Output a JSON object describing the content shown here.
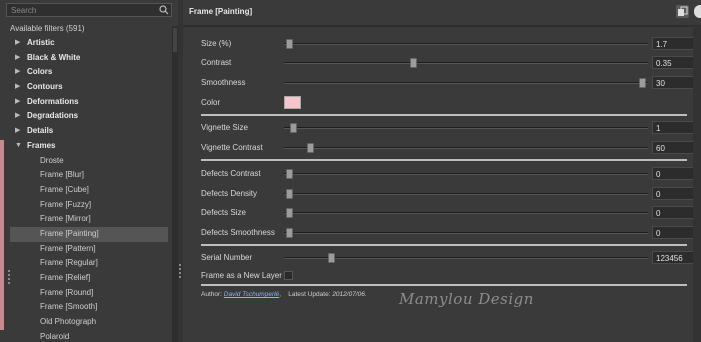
{
  "search": {
    "placeholder": "Search"
  },
  "filters_count_label": "Available filters (591)",
  "categories": [
    "Artistic",
    "Black & White",
    "Colors",
    "Contours",
    "Deformations",
    "Degradations",
    "Details",
    "Frames"
  ],
  "frames_items": [
    "Droste",
    "Frame [Blur]",
    "Frame [Cube]",
    "Frame [Fuzzy]",
    "Frame [Mirror]",
    "Frame [Painting]",
    "Frame [Pattern]",
    "Frame [Regular]",
    "Frame [Relief]",
    "Frame [Round]",
    "Frame [Smooth]",
    "Old Photograph",
    "Polaroid"
  ],
  "selected_item": "Frame [Painting]",
  "panel": {
    "title": "Frame [Painting]",
    "params": {
      "size": {
        "label": "Size (%)",
        "value": "1.7",
        "level": 0.0
      },
      "contrast": {
        "label": "Contrast",
        "value": "0.35",
        "level": 0.35
      },
      "smoothness": {
        "label": "Smoothness",
        "value": "30",
        "level": 1.0
      },
      "color": {
        "label": "Color",
        "swatch": "#f4c5cb"
      },
      "vignette_size": {
        "label": "Vignette Size",
        "value": "1",
        "level": 0.01
      },
      "vignette_contrast": {
        "label": "Vignette Contrast",
        "value": "60",
        "level": 0.06
      },
      "defects_contrast": {
        "label": "Defects Contrast",
        "value": "0",
        "level": 0
      },
      "defects_density": {
        "label": "Defects Density",
        "value": "0",
        "level": 0
      },
      "defects_size": {
        "label": "Defects Size",
        "value": "0",
        "level": 0
      },
      "defects_smoothness": {
        "label": "Defects Smoothness",
        "value": "0",
        "level": 0
      },
      "serial_number": {
        "label": "Serial Number",
        "value": "123456",
        "level": 0.12
      },
      "new_layer": {
        "label": "Frame as a New Layer"
      }
    },
    "footer": {
      "author_label": "Author:",
      "author_name": "David Tschumperlé",
      "update_label": "Latest Update:",
      "update_date": "2012/07/06"
    }
  },
  "watermark": "Mamylou Design",
  "colors": {
    "background": "#3a3a3a",
    "accent_pink": "#c98a8f"
  }
}
